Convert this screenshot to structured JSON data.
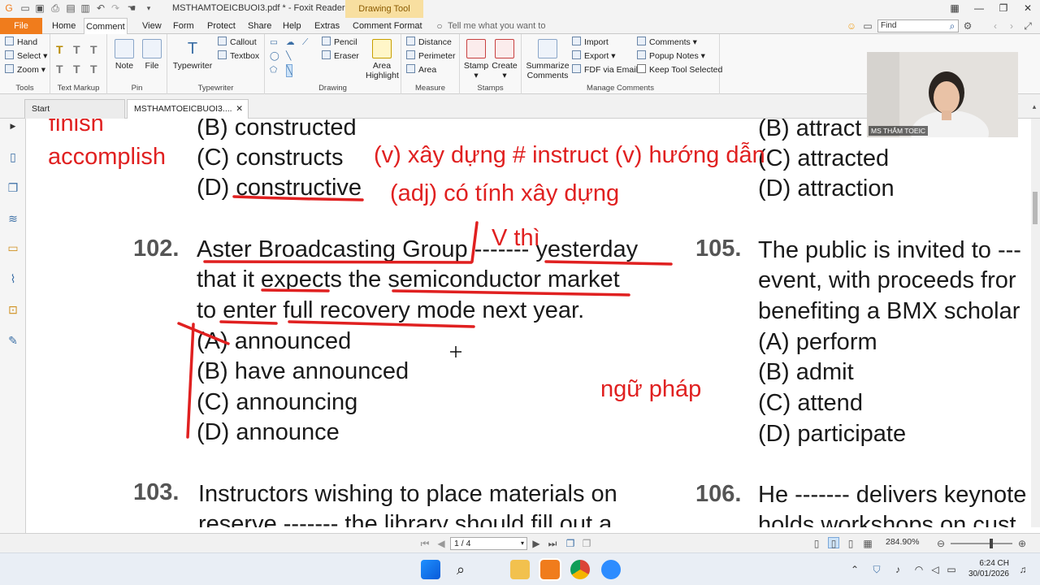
{
  "window": {
    "title": "MSTHAMTOEICBUOI3.pdf * - Foxit Reader",
    "context_tab": "Drawing Tool"
  },
  "menu": {
    "file": "File",
    "tabs": [
      "Home",
      "Comment",
      "View",
      "Form",
      "Protect",
      "Share",
      "Help",
      "Extras",
      "Comment Format"
    ],
    "active_tab": "Comment",
    "tell_me": "Tell me what you want to",
    "find_placeholder": "Find"
  },
  "ribbon": {
    "tools": {
      "label": "Tools",
      "hand": "Hand",
      "select": "Select",
      "zoom": "Zoom"
    },
    "text_markup": {
      "label": "Text Markup"
    },
    "pin": {
      "label": "Pin",
      "note": "Note",
      "file": "File"
    },
    "typewriter": {
      "label": "Typewriter",
      "typewriter": "Typewriter",
      "callout": "Callout",
      "textbox": "Textbox"
    },
    "drawing": {
      "label": "Drawing",
      "pencil": "Pencil",
      "eraser": "Eraser",
      "area_highlight": "Area\nHighlight"
    },
    "measure": {
      "label": "Measure",
      "distance": "Distance",
      "perimeter": "Perimeter",
      "area": "Area"
    },
    "stamps": {
      "label": "Stamps",
      "stamp": "Stamp",
      "create": "Create"
    },
    "manage": {
      "label": "Manage Comments",
      "summarize": "Summarize\nComments",
      "import": "Import",
      "export": "Export",
      "fdf": "FDF via Email",
      "comments": "Comments",
      "popup_notes": "Popup Notes",
      "keep_tool": "Keep Tool Selected"
    }
  },
  "doc_tabs": [
    "Start",
    "MSTHAMTOEICBUOI3...."
  ],
  "webcam": {
    "label": "MS THẮM TOEIC"
  },
  "document": {
    "q101_options": [
      "(B) constructed",
      "(C) constructs",
      "(D) constructive"
    ],
    "q102": {
      "num": "102.",
      "line1": "Aster Broadcasting Group ------- yesterday",
      "line2": "that it expects the semiconductor market",
      "line3": "to enter full recovery mode next year.",
      "options": [
        "(A) announced",
        "(B) have announced",
        "(C) announcing",
        "(D) announce"
      ]
    },
    "q103": {
      "num": "103.",
      "line1": "Instructors wishing to place materials on",
      "line2": "reserve ------- the library should fill out a"
    },
    "q104_options": [
      "(B) attract",
      "(C) attracted",
      "(D) attraction"
    ],
    "q105": {
      "num": "105.",
      "line1": "The public is invited to ---",
      "line2": "event, with proceeds fror",
      "line3": "benefiting a BMX scholar",
      "options": [
        "(A) perform",
        "(B) admit",
        "(C) attend",
        "(D) participate"
      ]
    },
    "q106": {
      "num": "106.",
      "line1": "He ------- delivers keynote",
      "line2": "holds workshops on cust"
    }
  },
  "annotations": {
    "finish": "finish",
    "accomplish": "accomplish",
    "verb_note": "(v) xây dựng # instruct (v) hướng dẫn",
    "adj_note": "(adj) có tính xây dựng",
    "v_thi": "V thì",
    "ngu_phap": "ngữ pháp"
  },
  "status": {
    "page": "1 / 4",
    "zoom": "284.90%"
  },
  "taskbar": {
    "time": "6:24 CH",
    "date": "30/01/2026"
  }
}
